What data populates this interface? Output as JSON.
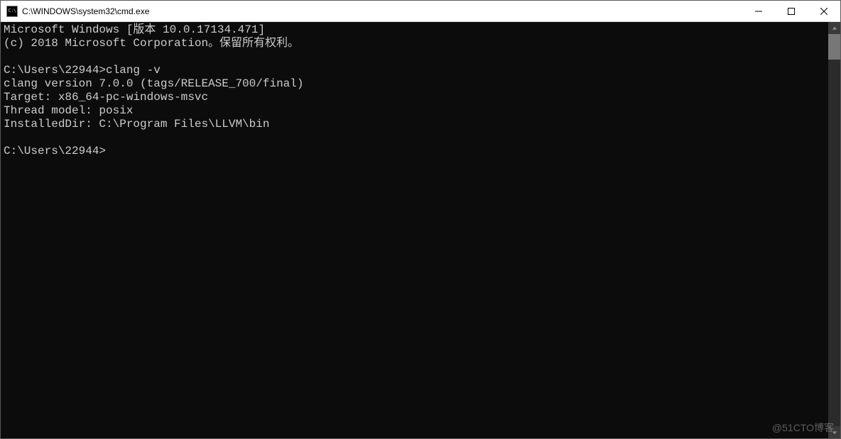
{
  "titlebar": {
    "icon_label": "C:\\",
    "title": "C:\\WINDOWS\\system32\\cmd.exe"
  },
  "terminal": {
    "lines": [
      "Microsoft Windows [版本 10.0.17134.471]",
      "(c) 2018 Microsoft Corporation。保留所有权利。",
      "",
      "C:\\Users\\22944>clang -v",
      "clang version 7.0.0 (tags/RELEASE_700/final)",
      "Target: x86_64-pc-windows-msvc",
      "Thread model: posix",
      "InstalledDir: C:\\Program Files\\LLVM\\bin",
      "",
      "C:\\Users\\22944>"
    ]
  },
  "watermark": "@51CTO博客"
}
